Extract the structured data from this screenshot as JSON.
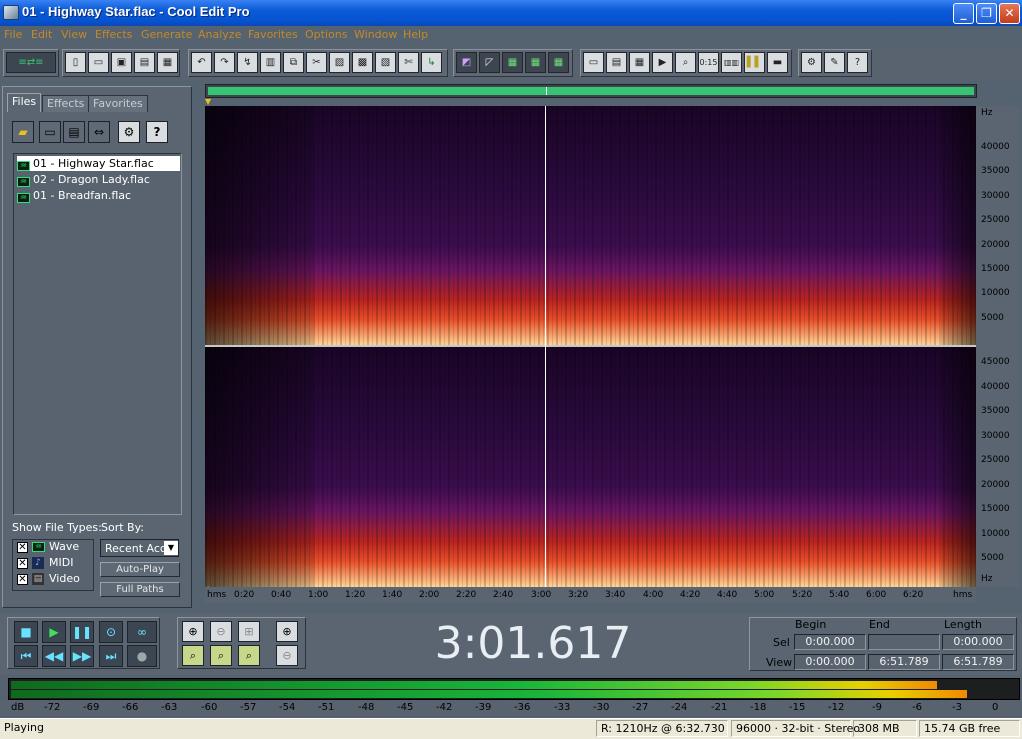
{
  "window": {
    "title": "01 - Highway Star.flac - Cool Edit Pro",
    "minimize": "_",
    "maximize": "❐",
    "close": "✕"
  },
  "menu": [
    "File",
    "Edit",
    "View",
    "Effects",
    "Generate",
    "Analyze",
    "Favorites",
    "Options",
    "Window",
    "Help"
  ],
  "toolbar_icons": [
    "multitrack-toggle-icon",
    "new-file-icon",
    "open-file-icon",
    "save-icon",
    "save-all-icon",
    "close-file-icon",
    "undo-icon",
    "redo-icon",
    "repeat-last-icon",
    "select-all-icon",
    "copy-icon",
    "cut-icon",
    "paste-icon",
    "paste-new-icon",
    "mix-paste-icon",
    "trim-icon",
    "envelope-icon",
    "waveform-view-icon",
    "spectral-view-icon",
    "vertical-scale-icon",
    "info-icon",
    "options-icon",
    "help-icon"
  ],
  "left_panel": {
    "tabs": [
      "Files",
      "Effects",
      "Favorites"
    ],
    "active_tab": "Files",
    "files": [
      "01 - Highway Star.flac",
      "02 - Dragon Lady.flac",
      "01 - Breadfan.flac"
    ],
    "selected_file": "01 - Highway Star.flac",
    "show_file_types_label": "Show File Types:",
    "file_types": [
      {
        "label": "Wave",
        "checked": true
      },
      {
        "label": "MIDI",
        "checked": true
      },
      {
        "label": "Video",
        "checked": true
      }
    ],
    "sort_by_label": "Sort By:",
    "sort_by_value": "Recent Acc",
    "auto_play_label": "Auto-Play",
    "full_paths_label": "Full Paths"
  },
  "spectral": {
    "x_ticks": [
      "hms",
      "0:20",
      "0:40",
      "1:00",
      "1:20",
      "1:40",
      "2:00",
      "2:20",
      "2:40",
      "3:00",
      "3:20",
      "3:40",
      "4:00",
      "4:20",
      "4:40",
      "5:00",
      "5:20",
      "5:40",
      "6:00",
      "6:20",
      "hms"
    ],
    "top_y_ticks": [
      "Hz",
      "40000",
      "35000",
      "30000",
      "25000",
      "20000",
      "15000",
      "10000",
      "5000"
    ],
    "bottom_y_ticks": [
      "45000",
      "40000",
      "35000",
      "30000",
      "25000",
      "20000",
      "15000",
      "10000",
      "5000",
      "Hz"
    ],
    "cursor_time": "3:00"
  },
  "transport": {
    "time": "3:01.617",
    "col_begin": "Begin",
    "col_end": "End",
    "col_length": "Length",
    "sel_label": "Sel",
    "view_label": "View",
    "sel_begin": "0:00.000",
    "sel_end": "",
    "sel_length": "0:00.000",
    "view_begin": "0:00.000",
    "view_end": "6:51.789",
    "view_length": "6:51.789"
  },
  "meter": {
    "scale": [
      "dB",
      "-72",
      "-69",
      "-66",
      "-63",
      "-60",
      "-57",
      "-54",
      "-51",
      "-48",
      "-45",
      "-42",
      "-39",
      "-36",
      "-33",
      "-30",
      "-27",
      "-24",
      "-21",
      "-18",
      "-15",
      "-12",
      "-9",
      "-6",
      "-3",
      "0"
    ],
    "level_left": 0.92,
    "level_right": 0.95
  },
  "status": {
    "state": "Playing",
    "readout": "R: 1210Hz @  6:32.730",
    "format": "96000 · 32-bit · Stereo",
    "size": "308 MB",
    "free": "15.74 GB free"
  },
  "colors": {
    "accent_green": "#37c472",
    "menu_text": "#c38a2b",
    "spectrum_hot": "#ffd89a",
    "spectrum_mid": "#e02a10",
    "spectrum_low": "#3a0a4a"
  }
}
